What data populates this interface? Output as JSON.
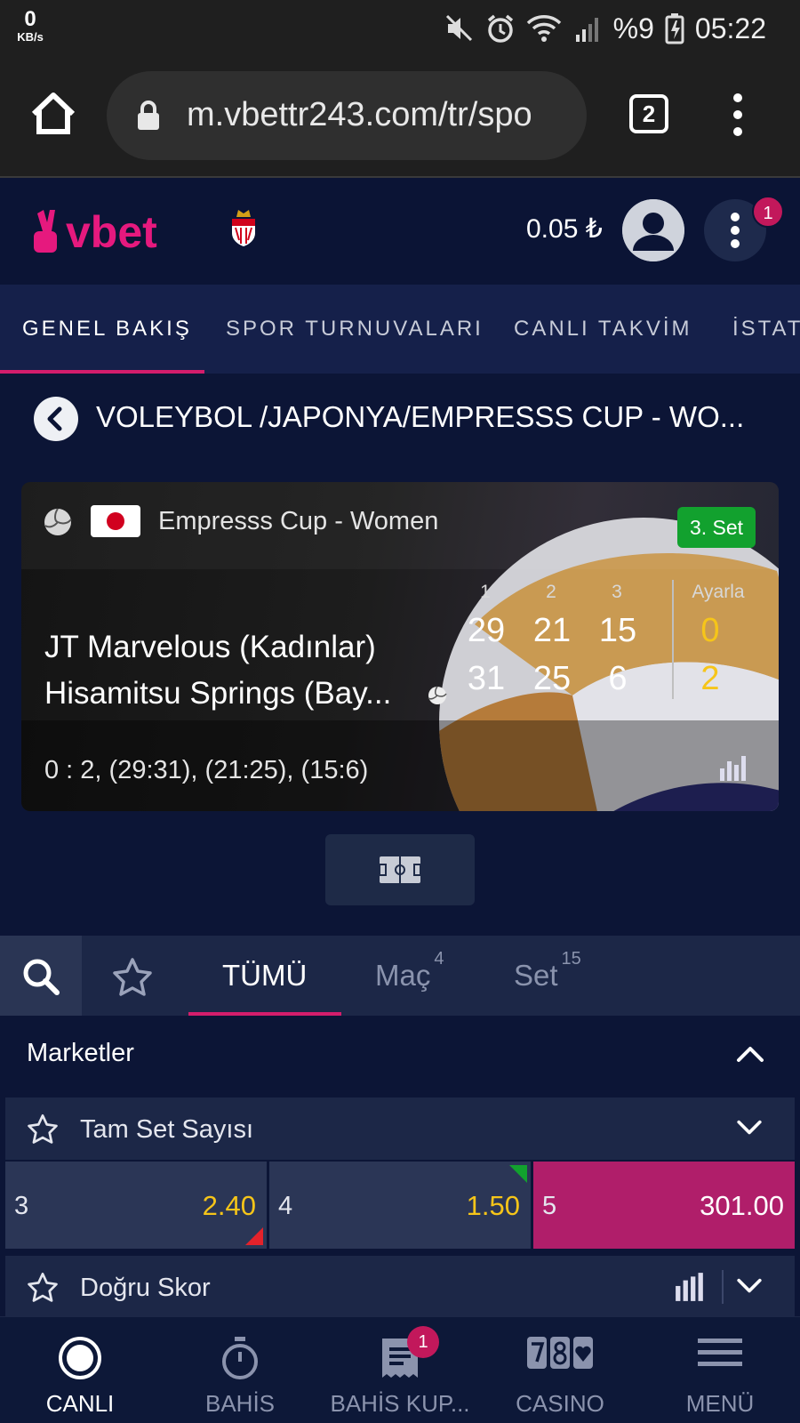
{
  "status_bar": {
    "net_speed_value": "0",
    "net_speed_unit": "KB/s",
    "battery_percent": "%9",
    "time": "05:22"
  },
  "browser": {
    "url": "m.vbettr243.com/tr/spo",
    "tab_count": "2"
  },
  "header": {
    "logo_text": "vbet",
    "balance": "0.05 ₺",
    "menu_badge": "1"
  },
  "top_tabs": [
    {
      "label": "GENEL BAKIŞ",
      "active": true
    },
    {
      "label": "SPOR TURNUVALARI",
      "active": false
    },
    {
      "label": "CANLI TAKVİM",
      "active": false
    },
    {
      "label": "İSTATİSTİK",
      "active": false
    }
  ],
  "breadcrumb": {
    "text": "VOLEYBOL /JAPONYA/EMPRESSS CUP - WO..."
  },
  "match": {
    "league": "Empresss Cup - Women",
    "set_badge": "3. Set",
    "set_headers": [
      "1",
      "2",
      "3"
    ],
    "total_header": "Ayarla",
    "team1": {
      "name": "JT Marvelous (Kadınlar)",
      "sets": [
        "29",
        "21",
        "15"
      ],
      "total": "0"
    },
    "team2": {
      "name": "Hisamitsu Springs (Bay...",
      "sets": [
        "31",
        "25",
        "6"
      ],
      "total": "2"
    },
    "summary": "0 : 2, (29:31), (21:25), (15:6)"
  },
  "market_tabs": [
    {
      "label": "TÜMÜ",
      "count": "",
      "active": true
    },
    {
      "label": "Maç",
      "count": "4",
      "active": false
    },
    {
      "label": "Set",
      "count": "15",
      "active": false
    }
  ],
  "markets_section": {
    "title": "Marketler"
  },
  "markets": [
    {
      "name": "Tam Set Sayısı",
      "odds": [
        {
          "label": "3",
          "value": "2.40",
          "trend": "down",
          "selected": false
        },
        {
          "label": "4",
          "value": "1.50",
          "trend": "up",
          "selected": false
        },
        {
          "label": "5",
          "value": "301.00",
          "trend": "",
          "selected": true
        }
      ]
    },
    {
      "name": "Doğru Skor",
      "odds": []
    }
  ],
  "bottom_nav": [
    {
      "label": "CANLI",
      "icon": "live-icon",
      "active": true
    },
    {
      "label": "BAHİS",
      "icon": "stopwatch-icon",
      "active": false
    },
    {
      "label": "BAHİS KUP...",
      "icon": "betslip-icon",
      "active": false,
      "badge": "1"
    },
    {
      "label": "CASINO",
      "icon": "slot-777-icon",
      "active": false
    },
    {
      "label": "MENÜ",
      "icon": "hamburger-icon",
      "active": false
    }
  ],
  "colors": {
    "accent": "#d41d6c",
    "odd_value": "#f6c519",
    "set_badge": "#12a12e",
    "background": "#0c1536"
  }
}
